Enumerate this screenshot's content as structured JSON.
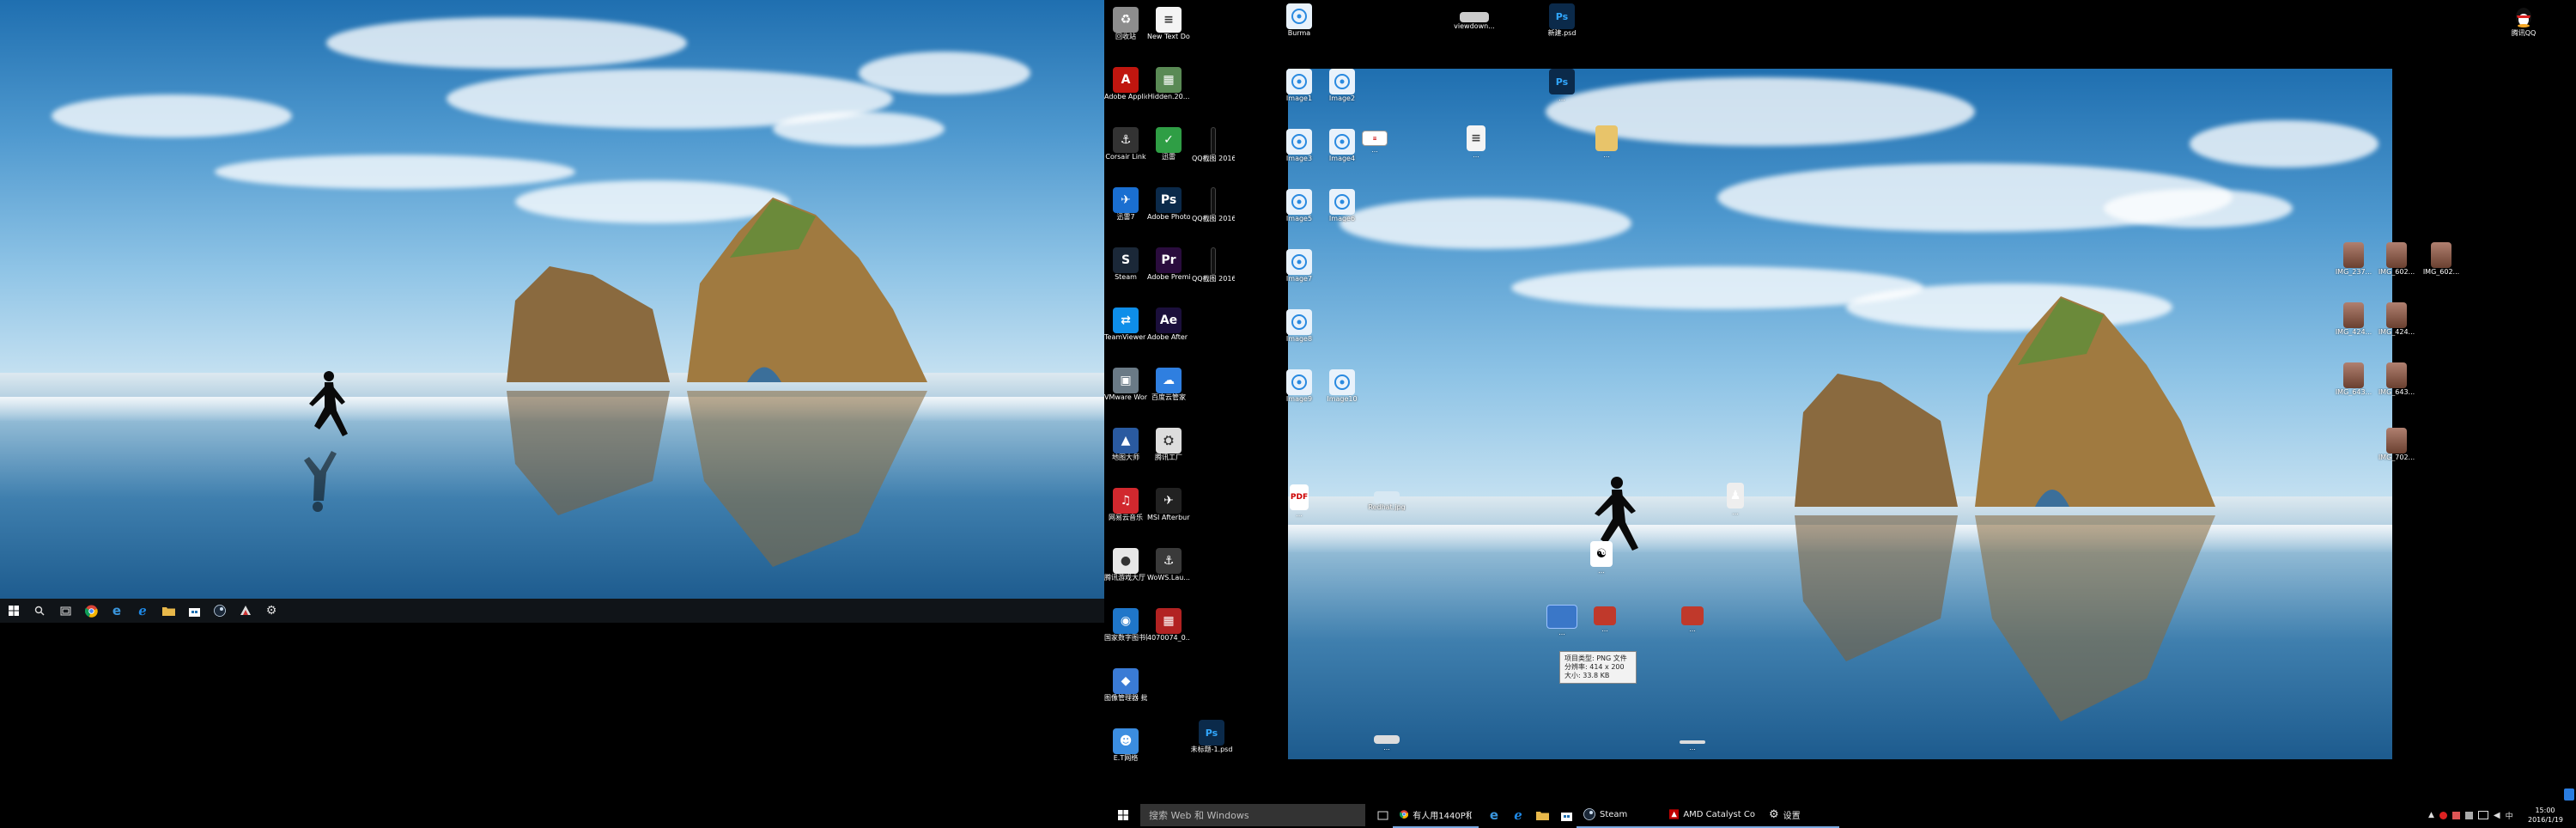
{
  "left_taskbar": {
    "start_icon": "windows-start-icon",
    "search_icon": "search-icon",
    "task_view_icon": "task-view-icon",
    "pinned": [
      "chrome-icon",
      "edge-icon",
      "ie-icon",
      "folder-icon",
      "store-icon",
      "steam-icon",
      "app-icon",
      "settings-icon"
    ]
  },
  "desktop_icons_col1": [
    {
      "label": "回收站",
      "icon": "recycle-bin-icon",
      "color": "#8d8d8d",
      "glyph": "♻"
    },
    {
      "label": "Adobe Applicat...",
      "icon": "adobe-app-manager-icon",
      "color": "#c0160f",
      "glyph": "A"
    },
    {
      "label": "Corsair Link",
      "icon": "corsair-icon",
      "color": "#333333",
      "glyph": "⚓"
    },
    {
      "label": "迅雷7",
      "icon": "xunlei-icon",
      "color": "#1a6fd1",
      "glyph": "✈"
    },
    {
      "label": "Steam",
      "icon": "steam-icon",
      "color": "#1b2838",
      "glyph": "S"
    },
    {
      "label": "TeamViewer 10",
      "icon": "teamviewer-icon",
      "color": "#0e8ee9",
      "glyph": "⇄"
    },
    {
      "label": "VMware Workstation",
      "icon": "vmware-icon",
      "color": "#6a7a86",
      "glyph": "▣"
    },
    {
      "label": "地图大师",
      "icon": "map-icon",
      "color": "#2a5aa0",
      "glyph": "▲"
    },
    {
      "label": "网易云音乐",
      "icon": "netease-music-icon",
      "color": "#d1282e",
      "glyph": "♫"
    },
    {
      "label": "腾讯游戏大厅 微信",
      "icon": "game-hall-icon",
      "color": "#e7e7e7",
      "glyph": "●"
    },
    {
      "label": "国家数字图书馆 云阅读",
      "icon": "library-icon",
      "color": "#1f76c9",
      "glyph": "◉"
    },
    {
      "label": "图像管理器 批量工具",
      "icon": "image-tool-icon",
      "color": "#3a7bd5",
      "glyph": "◆"
    },
    {
      "label": "E.T网络",
      "icon": "network-icon",
      "color": "#3b8de0",
      "glyph": "☻"
    }
  ],
  "desktop_icons_col2": [
    {
      "label": "New Text Document...",
      "icon": "text-document-icon",
      "color": "#f4f4f4",
      "glyph": "≡"
    },
    {
      "label": "Hidden.20...",
      "icon": "image-file-icon",
      "color": "#5a8a55",
      "glyph": "▦"
    },
    {
      "label": "迅雷",
      "icon": "xunlei-browser-icon",
      "color": "#2f9e45",
      "glyph": "✓"
    },
    {
      "label": "Adobe Photosh...",
      "icon": "photoshop-icon",
      "color": "#0b2a4a",
      "glyph": "Ps"
    },
    {
      "label": "Adobe Premier...",
      "icon": "premiere-icon",
      "color": "#2a0c3d",
      "glyph": "Pr"
    },
    {
      "label": "Adobe After Effects CC ...",
      "icon": "after-effects-icon",
      "color": "#1b0f3b",
      "glyph": "Ae"
    },
    {
      "label": "百度云管家",
      "icon": "baidu-cloud-icon",
      "color": "#2f7fe0",
      "glyph": "☁"
    },
    {
      "label": "腾讯工厂",
      "icon": "cloud-tool-icon",
      "color": "#dddddd",
      "glyph": "⛭"
    },
    {
      "label": "MSI Afterburner",
      "icon": "msi-afterburner-icon",
      "color": "#222222",
      "glyph": "✈"
    },
    {
      "label": "WoWS.Lau... - Shortcut",
      "icon": "wows-icon",
      "color": "#3a3a3a",
      "glyph": "⚓"
    },
    {
      "label": "4070074_0...",
      "icon": "photo-file-icon",
      "color": "#b22222",
      "glyph": "▦"
    }
  ],
  "desktop_icons_col3": [
    {
      "label": "QQ截图 20160119...",
      "icon": "screenshot-file-icon"
    },
    {
      "label": "QQ截图 20160119...",
      "icon": "screenshot-file-icon"
    },
    {
      "label": "QQ截图 20160119...",
      "icon": "screenshot-file-icon"
    }
  ],
  "psd_file": {
    "label": "未标题-1.psd",
    "glyph": "Ps"
  },
  "top_icons": [
    {
      "label": "Burma",
      "icon": "disc-icon"
    },
    {
      "label": "viewdown...",
      "icon": "image-file-icon"
    },
    {
      "label": "新建.psd",
      "icon": "photoshop-file-icon"
    }
  ],
  "qq_icon_label": "腾讯QQ",
  "preview_icons": {
    "disc_labels": [
      "Image1",
      "Image2",
      "Image3",
      "Image4",
      "Image5",
      "Image6",
      "Image7",
      "Image8",
      "Image9",
      "Image10"
    ],
    "small_labels": [
      "Burma",
      "...",
      "...",
      "...",
      "...",
      "...",
      "...",
      "...",
      "...",
      "...",
      "IMG_237...",
      "IMG_602...",
      "IMG_602...",
      "IMG_424...",
      "IMG_643...",
      "IMG_702...",
      "Redhat.jpg"
    ]
  },
  "tooltip": {
    "line1": "项目类型: PNG 文件",
    "line2": "分辨率: 414 x 200",
    "line3": "大小: 33.8 KB"
  },
  "right_taskbar": {
    "search_placeholder": "搜索 Web 和 Windows",
    "tasks": [
      {
        "label": "有人用1440P和10...",
        "icon": "chrome-icon",
        "color": "#e44134"
      },
      {
        "label": "Steam",
        "icon": "steam-icon",
        "color": "#1b2838"
      },
      {
        "label": "AMD Catalyst Cont...",
        "icon": "amd-icon",
        "color": "#c00000"
      },
      {
        "label": "设置",
        "icon": "gear-icon",
        "color": "#888888"
      }
    ],
    "clock_time": "15:00",
    "clock_date": "2016/1/19"
  },
  "colors": {
    "taskbar_bg": "#101418",
    "taskbar_right_bg": "#000000",
    "accent": "#7aa8e0"
  }
}
